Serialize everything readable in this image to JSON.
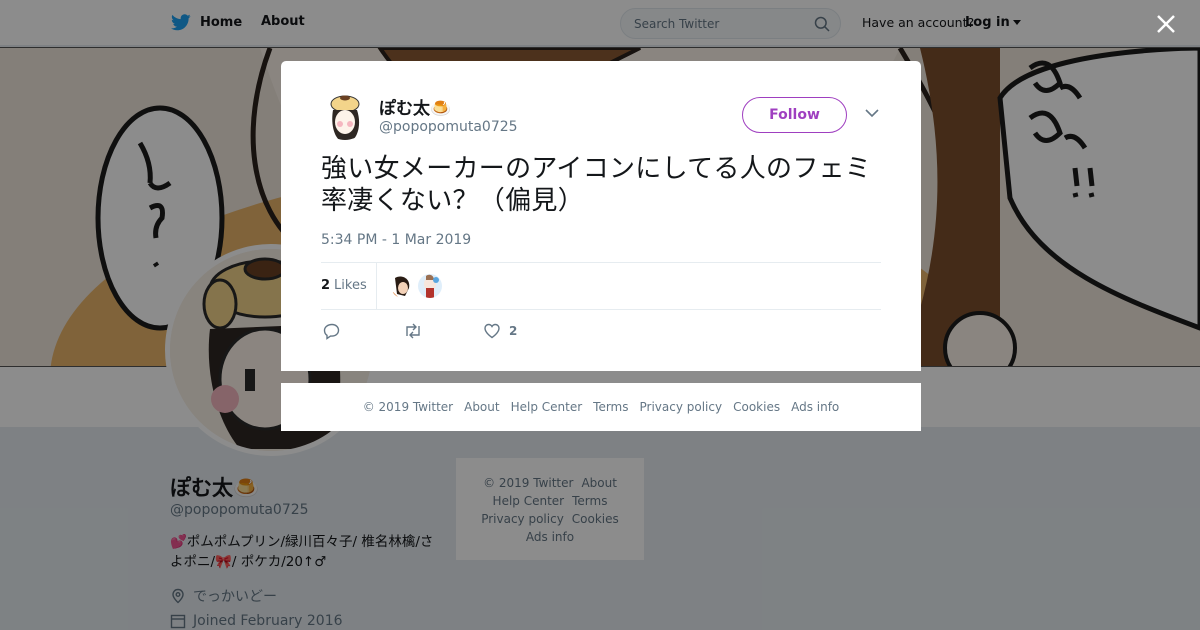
{
  "topbar": {
    "home_label": "Home",
    "about_label": "About",
    "search_placeholder": "Search Twitter",
    "have_account": "Have an account?",
    "login_label": "Log in"
  },
  "profile": {
    "name": "ぽむ太🍮",
    "handle": "@popopomuta0725",
    "bio": "💕ポムポムプリン/緑川百々子/ 椎名林檎/さよポニ/🎀/ ポケカ/20↑♂",
    "location": "でっかいどー",
    "joined": "Joined February 2016"
  },
  "side_footer": {
    "links": [
      "© 2019 Twitter",
      "About",
      "Help Center",
      "Terms",
      "Privacy policy",
      "Cookies",
      "Ads info"
    ]
  },
  "tweet": {
    "name": "ぽむ太🍮",
    "handle": "@popopomuta0725",
    "follow_label": "Follow",
    "text": "強い女メーカーのアイコンにしてる人のフェミ率凄くない？（偏見）",
    "timestamp": "5:34 PM - 1 Mar 2019",
    "likes_count": "2",
    "likes_label": "Likes",
    "action_like_count": "2"
  },
  "modal_footer": {
    "links": [
      "© 2019 Twitter",
      "About",
      "Help Center",
      "Terms",
      "Privacy policy",
      "Cookies",
      "Ads info"
    ]
  },
  "colors": {
    "accent": "#9f3fc0",
    "twitter_blue": "#1da1f2",
    "overlay": "rgba(0,0,0,0.45)"
  },
  "icons": [
    "twitter-bird-icon",
    "search-icon",
    "close-icon",
    "chevron-down-icon",
    "reply-icon",
    "retweet-icon",
    "heart-icon",
    "location-icon",
    "calendar-icon"
  ]
}
